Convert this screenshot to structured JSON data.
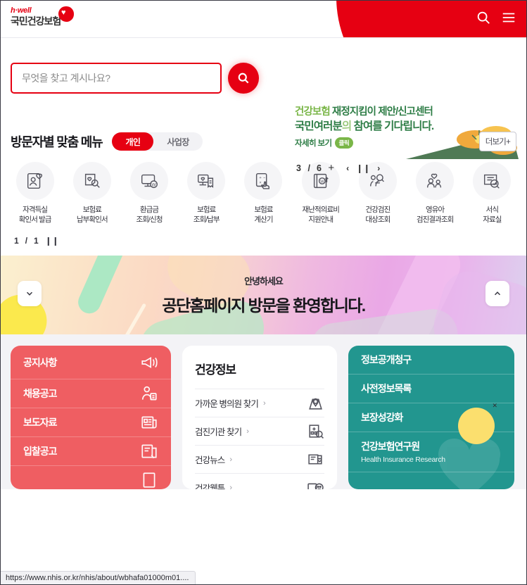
{
  "header": {
    "logo_brand": "h·well",
    "logo_name": "국민건강보험",
    "search_icon": "search-icon",
    "menu_icon": "hamburger-menu-icon",
    "accent_color": "#e60012"
  },
  "search": {
    "placeholder": "무엇을 찾고 계시나요?",
    "value": "",
    "button_icon": "search-icon"
  },
  "promo": {
    "line1_part1": "건강보험 ",
    "line1_part2": "재정지킴이 제안/신고센터",
    "line2_part1": "국민여러분",
    "line2_part2": "의 ",
    "line2_part3": "참여를 기다립니다.",
    "more_label": "자세히 보기",
    "badge": "클릭",
    "current": "3",
    "separator": "/",
    "total": "6",
    "plus": "+",
    "prev_icon": "chevron-left-icon",
    "pause_icon": "pause-icon",
    "next_icon": "chevron-right-icon"
  },
  "menu_section": {
    "title": "방문자별 맞춤 메뉴",
    "tabs": [
      {
        "label": "개인",
        "active": true
      },
      {
        "label": "사업장",
        "active": false
      }
    ],
    "more_label": "더보기+",
    "items": [
      {
        "line1": "자격득실",
        "line2": "확인서 발급",
        "icon": "id-card-heart-icon"
      },
      {
        "line1": "보험료",
        "line2": "납부확인서",
        "icon": "document-search-heart-icon"
      },
      {
        "line1": "환급금",
        "line2": "조회/신청",
        "icon": "monitor-won-icon"
      },
      {
        "line1": "보험료",
        "line2": "조회/납부",
        "icon": "monitor-receipt-icon"
      },
      {
        "line1": "보험료",
        "line2": "계산기",
        "icon": "calculator-hand-icon"
      },
      {
        "line1": "재난적의료비",
        "line2": "지원안내",
        "icon": "book-won-arrow-icon"
      },
      {
        "line1": "건강검진",
        "line2": "대상조회",
        "icon": "person-magnifier-icon"
      },
      {
        "line1": "영유아",
        "line2": "검진결과조회",
        "icon": "parent-child-heart-icon"
      },
      {
        "line1": "서식",
        "line2": "자료실",
        "icon": "form-check-magnifier-icon"
      }
    ],
    "pager_current": "1",
    "pager_sep": "/",
    "pager_total": "1",
    "pager_pause_icon": "pause-icon"
  },
  "welcome": {
    "greeting": "안녕하세요",
    "message": "공단홈페이지 방문을 환영합니다.",
    "prev_icon": "chevron-down-icon",
    "next_icon": "chevron-up-icon"
  },
  "cards": {
    "notice_card": {
      "color": "#ef5e62",
      "items": [
        {
          "label": "공지사항",
          "icon": "megaphone-icon"
        },
        {
          "label": "채용공고",
          "icon": "person-badge-icon"
        },
        {
          "label": "보도자료",
          "icon": "newspaper-icon"
        },
        {
          "label": "입찰공고",
          "icon": "bid-document-icon"
        }
      ]
    },
    "health_card": {
      "title": "건강정보",
      "items": [
        {
          "label": "가까운 병의원 찾기",
          "chevron": "›",
          "icon": "map-pin-icon"
        },
        {
          "label": "검진기관 찾기",
          "chevron": "›",
          "icon": "hospital-search-icon"
        },
        {
          "label": "건강뉴스",
          "chevron": "›",
          "icon": "news-heart-icon"
        },
        {
          "label": "건강웹툰",
          "chevron": "›",
          "icon": "webtoon-smile-icon"
        }
      ]
    },
    "info_card": {
      "color": "#22968f",
      "items": [
        {
          "label": "정보공개청구",
          "sub": ""
        },
        {
          "label": "사전정보목록",
          "sub": ""
        },
        {
          "label": "보장성강화",
          "sub": ""
        },
        {
          "label": "건강보험연구원",
          "sub": "Health Insurance Research"
        }
      ],
      "close_icon": "close-icon"
    }
  },
  "statusbar": {
    "url": "https://www.nhis.or.kr/nhis/about/wbhafa01000m01...."
  }
}
